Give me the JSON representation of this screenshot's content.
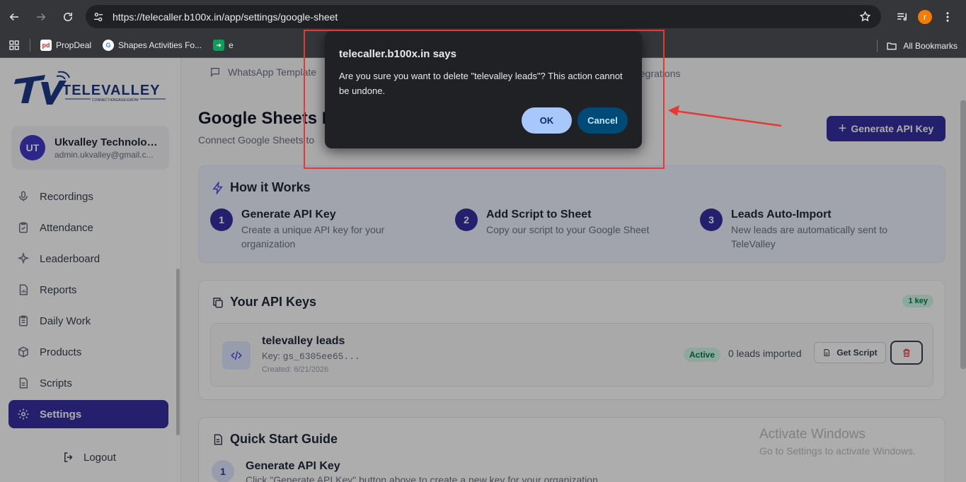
{
  "browser": {
    "url": "https://telecaller.b100x.in/app/settings/google-sheet",
    "profile_initial": "r",
    "bookmarks": [
      {
        "label": "PropDeal",
        "icon": "propdeal-favicon"
      },
      {
        "label": "Shapes Activities Fo...",
        "icon": "google-favicon"
      },
      {
        "label": "e",
        "icon": "green-favicon"
      }
    ],
    "all_bookmarks": "All Bookmarks"
  },
  "sidebar": {
    "user_initials": "UT",
    "user_name": "Ukvalley Technolog...",
    "user_email": "admin.ukvalley@gmail.c...",
    "items": [
      {
        "label": "Recordings",
        "icon": "mic-icon"
      },
      {
        "label": "Attendance",
        "icon": "clipboard-check-icon"
      },
      {
        "label": "Leaderboard",
        "icon": "sparkles-icon"
      },
      {
        "label": "Reports",
        "icon": "report-icon"
      },
      {
        "label": "Daily Work",
        "icon": "clipboard-icon"
      },
      {
        "label": "Products",
        "icon": "box-icon"
      },
      {
        "label": "Scripts",
        "icon": "file-text-icon"
      },
      {
        "label": "Settings",
        "icon": "gear-icon"
      }
    ],
    "logout": "Logout"
  },
  "main": {
    "tab_whatsapp": "WhatsApp Template",
    "tab_integrations": "tegrations",
    "title": "Google Sheets I",
    "subtitle": "Connect Google Sheets to",
    "generate_btn": "Generate API Key",
    "how": {
      "title": "How it Works",
      "steps": [
        {
          "num": "1",
          "title": "Generate API Key",
          "desc": "Create a unique API key for your organization"
        },
        {
          "num": "2",
          "title": "Add Script to Sheet",
          "desc": "Copy our script to your Google Sheet"
        },
        {
          "num": "3",
          "title": "Leads Auto-Import",
          "desc": "New leads are automatically sent to TeleValley"
        }
      ]
    },
    "keys": {
      "title": "Your API Keys",
      "count": "1 key",
      "row": {
        "name": "televalley leads",
        "key_label": "Key: ",
        "key_value": "gs_6305ee65...",
        "created": "Created: 6/21/2026",
        "status": "Active",
        "leads": "0 leads imported",
        "script_btn": "Get Script"
      }
    },
    "quick": {
      "title": "Quick Start Guide",
      "step_num": "1",
      "step_title": "Generate API Key",
      "step_desc": "Click \"Generate API Key\" button above to create a new key for your organization"
    }
  },
  "dialog": {
    "title": "telecaller.b100x.in says",
    "message": "Are you sure you want to delete \"televalley leads\"? This action cannot be undone.",
    "ok": "OK",
    "cancel": "Cancel"
  },
  "watermark": {
    "line1": "Activate Windows",
    "line2": "Go to Settings to activate Windows."
  },
  "colors": {
    "accent": "#3730a3",
    "annotation": "#e53935",
    "dialog_bg": "#202124"
  }
}
